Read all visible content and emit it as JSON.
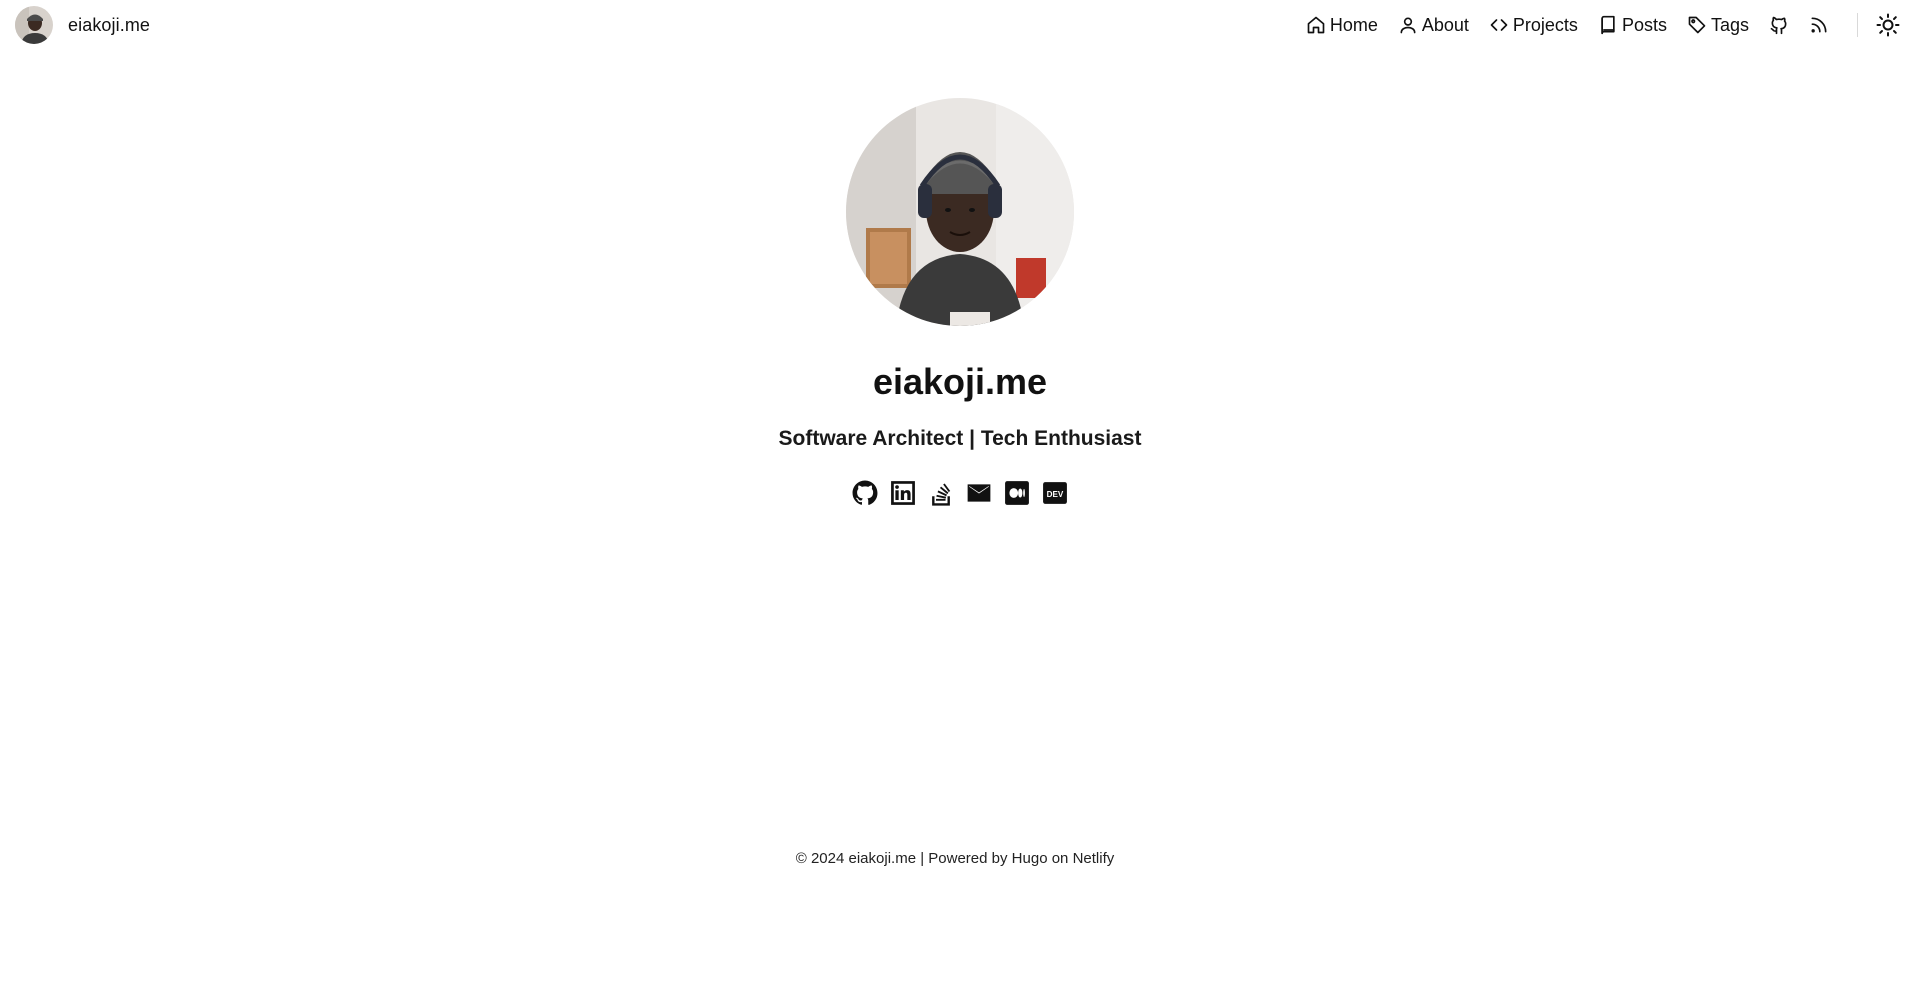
{
  "header": {
    "brand_text": "eiakoji.me",
    "nav": [
      {
        "label": "Home",
        "icon": "home-icon"
      },
      {
        "label": "About",
        "icon": "user-icon"
      },
      {
        "label": "Projects",
        "icon": "code-icon"
      },
      {
        "label": "Posts",
        "icon": "book-icon"
      },
      {
        "label": "Tags",
        "icon": "tag-icon"
      }
    ],
    "nav_icons": [
      "github-icon",
      "rss-icon"
    ],
    "theme_toggle_icon": "sun-icon"
  },
  "profile": {
    "name": "eiakoji.me",
    "subtitle": "Software Architect | Tech Enthusiast",
    "socials": [
      "github-icon",
      "linkedin-icon",
      "stackoverflow-icon",
      "email-icon",
      "medium-icon",
      "dev-icon"
    ]
  },
  "footer": {
    "copyright": "© 2024 eiakoji.me",
    "separator": " | ",
    "powered_by": "Powered by ",
    "hugo": "Hugo",
    "on": " on ",
    "netlify": "Netlify"
  },
  "colors": {
    "background": "#ffffff",
    "text": "#111111"
  }
}
